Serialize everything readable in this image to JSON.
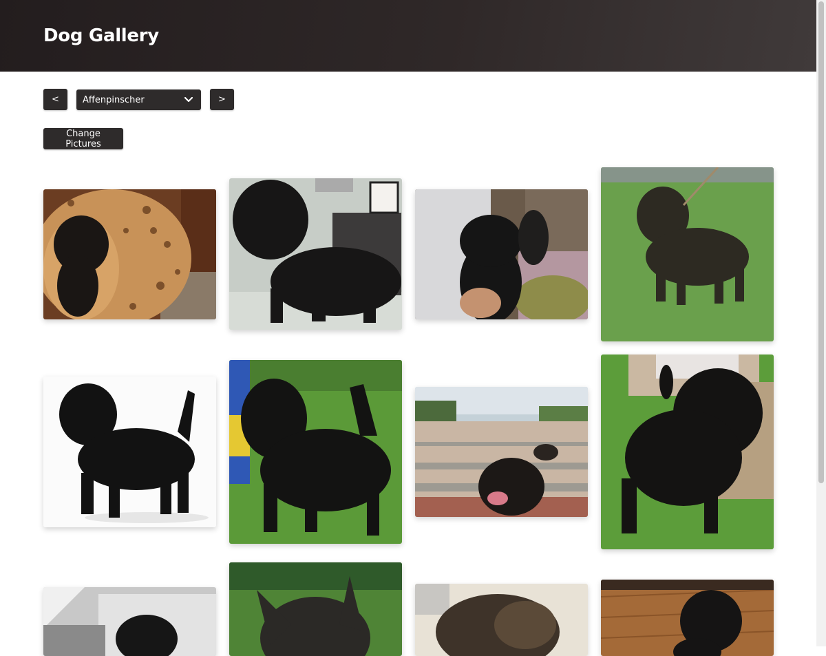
{
  "header": {
    "title": "Dog Gallery"
  },
  "controls": {
    "prev_label": "<",
    "next_label": ">",
    "breed_selected": "Affenpinscher",
    "change_label": "Change Pictures"
  },
  "gallery": {
    "photos": [
      "affenpinscher-photo",
      "affenpinscher-photo",
      "affenpinscher-photo",
      "affenpinscher-photo",
      "affenpinscher-photo",
      "affenpinscher-photo",
      "affenpinscher-photo",
      "affenpinscher-photo",
      "affenpinscher-photo",
      "affenpinscher-photo",
      "affenpinscher-photo",
      "affenpinscher-photo"
    ]
  }
}
